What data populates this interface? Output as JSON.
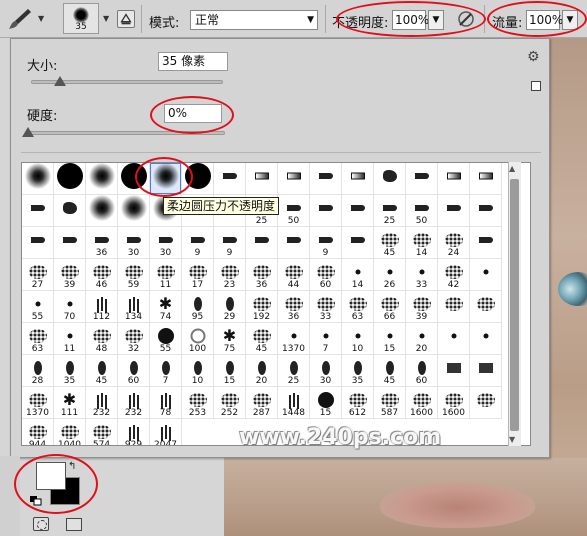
{
  "optionbar": {
    "brush_size": "35",
    "mode_label": "模式:",
    "mode_value": "正常",
    "opacity_label": "不透明度:",
    "opacity_value": "100%",
    "flow_label": "流量:",
    "flow_value": "100%"
  },
  "panel": {
    "size_label": "大小:",
    "size_value": "35 像素",
    "size_slider_fraction": 0.18,
    "hardness_label": "硬度:",
    "hardness_value": "0%",
    "hardness_slider_fraction": 0.0,
    "tooltip": "柔边圆压力不透明度",
    "presets": [
      {
        "shape": "soft",
        "n": ""
      },
      {
        "shape": "hard",
        "n": ""
      },
      {
        "shape": "soft",
        "n": ""
      },
      {
        "shape": "hard",
        "n": ""
      },
      {
        "shape": "soft",
        "n": "",
        "selected": true
      },
      {
        "shape": "hard",
        "n": ""
      },
      {
        "shape": "tip",
        "n": ""
      },
      {
        "shape": "flat",
        "n": ""
      },
      {
        "shape": "flat",
        "n": ""
      },
      {
        "shape": "tip",
        "n": ""
      },
      {
        "shape": "flat",
        "n": ""
      },
      {
        "shape": "blob",
        "n": ""
      },
      {
        "shape": "tip",
        "n": ""
      },
      {
        "shape": "flat",
        "n": ""
      },
      {
        "shape": "flat",
        "n": ""
      },
      {
        "shape": "tip",
        "n": ""
      },
      {
        "shape": "blob",
        "n": ""
      },
      {
        "shape": "soft",
        "n": ""
      },
      {
        "shape": "soft",
        "n": ""
      },
      {
        "shape": "soft",
        "n": ""
      },
      {
        "shape": "tip",
        "n": ""
      },
      {
        "shape": "tip",
        "n": ""
      },
      {
        "shape": "tip",
        "n": "25"
      },
      {
        "shape": "tip",
        "n": "50"
      },
      {
        "shape": "tip",
        "n": ""
      },
      {
        "shape": "tip",
        "n": ""
      },
      {
        "shape": "tip",
        "n": "25"
      },
      {
        "shape": "tip",
        "n": "50"
      },
      {
        "shape": "tip",
        "n": ""
      },
      {
        "shape": "tip",
        "n": ""
      },
      {
        "shape": "tip",
        "n": ""
      },
      {
        "shape": "tip",
        "n": ""
      },
      {
        "shape": "tip",
        "n": "36"
      },
      {
        "shape": "tip",
        "n": "30"
      },
      {
        "shape": "tip",
        "n": "30"
      },
      {
        "shape": "tip",
        "n": "9"
      },
      {
        "shape": "tip",
        "n": "9"
      },
      {
        "shape": "tip",
        "n": ""
      },
      {
        "shape": "tip",
        "n": ""
      },
      {
        "shape": "tip",
        "n": "9"
      },
      {
        "shape": "tip",
        "n": ""
      },
      {
        "shape": "spray",
        "n": "45"
      },
      {
        "shape": "spray",
        "n": "14"
      },
      {
        "shape": "spray",
        "n": "24"
      },
      {
        "shape": "tip",
        "n": ""
      },
      {
        "shape": "spray",
        "n": "27"
      },
      {
        "shape": "spray",
        "n": "39"
      },
      {
        "shape": "spray",
        "n": "46"
      },
      {
        "shape": "spray",
        "n": "59"
      },
      {
        "shape": "spray",
        "n": "11"
      },
      {
        "shape": "spray",
        "n": "17"
      },
      {
        "shape": "spray",
        "n": "23"
      },
      {
        "shape": "spray",
        "n": "36"
      },
      {
        "shape": "spray",
        "n": "44"
      },
      {
        "shape": "spray",
        "n": "60"
      },
      {
        "shape": "dot",
        "n": "14"
      },
      {
        "shape": "dot",
        "n": "26"
      },
      {
        "shape": "dot",
        "n": "33"
      },
      {
        "shape": "spray",
        "n": "42"
      },
      {
        "shape": "dot",
        "n": ""
      },
      {
        "shape": "dot",
        "n": "55"
      },
      {
        "shape": "dot",
        "n": "70"
      },
      {
        "shape": "grass",
        "n": "112"
      },
      {
        "shape": "grass",
        "n": "134"
      },
      {
        "shape": "star",
        "n": "74"
      },
      {
        "shape": "leaf",
        "n": "95"
      },
      {
        "shape": "leaf",
        "n": "29"
      },
      {
        "shape": "spray",
        "n": "192"
      },
      {
        "shape": "spray",
        "n": "36"
      },
      {
        "shape": "spray",
        "n": "33"
      },
      {
        "shape": "spray",
        "n": "63"
      },
      {
        "shape": "spray",
        "n": "66"
      },
      {
        "shape": "spray",
        "n": "39"
      },
      {
        "shape": "spray",
        "n": ""
      },
      {
        "shape": "spray",
        "n": ""
      },
      {
        "shape": "spray",
        "n": "63"
      },
      {
        "shape": "dot",
        "n": "11"
      },
      {
        "shape": "spray",
        "n": "48"
      },
      {
        "shape": "spray",
        "n": "32"
      },
      {
        "shape": "circle",
        "n": "55"
      },
      {
        "shape": "ring",
        "n": "100"
      },
      {
        "shape": "star",
        "n": "75"
      },
      {
        "shape": "spray",
        "n": "45"
      },
      {
        "shape": "dot",
        "n": "1370"
      },
      {
        "shape": "dot",
        "n": "7"
      },
      {
        "shape": "dot",
        "n": "10"
      },
      {
        "shape": "dot",
        "n": "15"
      },
      {
        "shape": "dot",
        "n": "20"
      },
      {
        "shape": "dot",
        "n": ""
      },
      {
        "shape": "dot",
        "n": ""
      },
      {
        "shape": "leaf",
        "n": "28"
      },
      {
        "shape": "leaf",
        "n": "35"
      },
      {
        "shape": "leaf",
        "n": "45"
      },
      {
        "shape": "leaf",
        "n": "60"
      },
      {
        "shape": "leaf",
        "n": "7"
      },
      {
        "shape": "leaf",
        "n": "10"
      },
      {
        "shape": "leaf",
        "n": "15"
      },
      {
        "shape": "leaf",
        "n": "20"
      },
      {
        "shape": "leaf",
        "n": "25"
      },
      {
        "shape": "leaf",
        "n": "30"
      },
      {
        "shape": "leaf",
        "n": "35"
      },
      {
        "shape": "leaf",
        "n": "45"
      },
      {
        "shape": "leaf",
        "n": "60"
      },
      {
        "shape": "sq",
        "n": ""
      },
      {
        "shape": "sq",
        "n": ""
      },
      {
        "shape": "spray",
        "n": "1370"
      },
      {
        "shape": "star",
        "n": "111"
      },
      {
        "shape": "grass",
        "n": "232"
      },
      {
        "shape": "grass",
        "n": "232"
      },
      {
        "shape": "grass",
        "n": "78"
      },
      {
        "shape": "spray",
        "n": "253"
      },
      {
        "shape": "spray",
        "n": "252"
      },
      {
        "shape": "spray",
        "n": "287"
      },
      {
        "shape": "grass",
        "n": "1448"
      },
      {
        "shape": "circle",
        "n": "15"
      },
      {
        "shape": "spray",
        "n": "612"
      },
      {
        "shape": "spray",
        "n": "587"
      },
      {
        "shape": "spray",
        "n": "1600"
      },
      {
        "shape": "spray",
        "n": "1600"
      },
      {
        "shape": "spray",
        "n": ""
      },
      {
        "shape": "spray",
        "n": "944"
      },
      {
        "shape": "spray",
        "n": "1040"
      },
      {
        "shape": "spray",
        "n": "574"
      },
      {
        "shape": "grass",
        "n": "929"
      },
      {
        "shape": "grass",
        "n": "2047"
      }
    ]
  },
  "watermark": "www.240ps.com",
  "colors": {
    "highlight_ring": "#e0101b",
    "foreground": "#ffffff",
    "background": "#000000"
  },
  "icons": [
    "brush-tool-icon",
    "toggle-brush-panel-icon",
    "airbrush-icon",
    "gear-icon",
    "new-preset-icon",
    "swap-colors-icon",
    "default-colors-icon",
    "quick-mask-icon",
    "screen-mode-icon"
  ]
}
